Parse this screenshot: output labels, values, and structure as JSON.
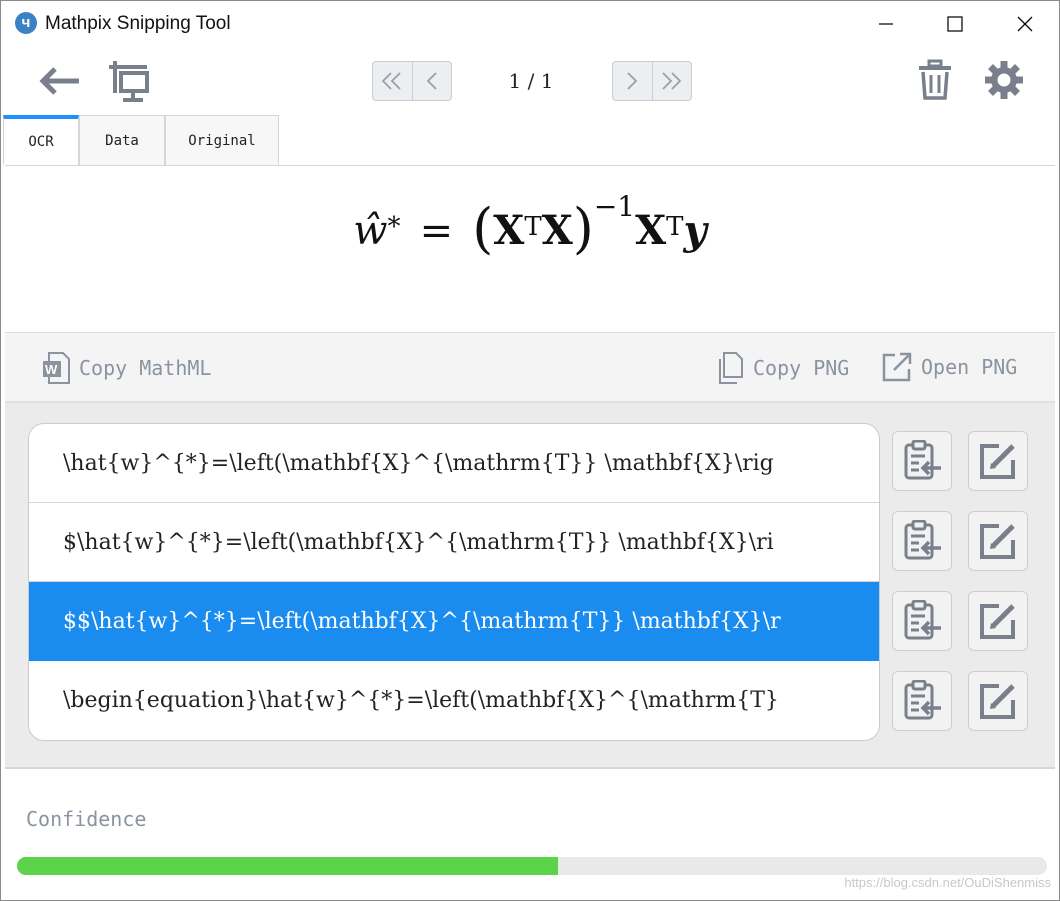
{
  "window": {
    "title": "Mathpix Snipping Tool",
    "logo_glyph": "ч",
    "controls": [
      "minimize-icon",
      "maximize-icon",
      "close-icon"
    ]
  },
  "toolbar": {
    "back_icon": "arrow-left-icon",
    "snip_icon": "screen-crop-icon",
    "page_indicator": "1 / 1",
    "pager_left": [
      "double-chevron-left-icon",
      "chevron-left-icon"
    ],
    "pager_right": [
      "chevron-right-icon",
      "double-chevron-right-icon"
    ],
    "delete_icon": "trash-icon",
    "settings_icon": "gear-icon"
  },
  "tabs": [
    {
      "label": "OCR",
      "active": true
    },
    {
      "label": "Data",
      "active": false
    },
    {
      "label": "Original",
      "active": false
    }
  ],
  "preview": {
    "equation_parts": {
      "w": "ŵ",
      "star": "*",
      "eq": "=",
      "lp": "(",
      "X1": "X",
      "T1": "T",
      "X2": "X",
      "rp": ")",
      "inv": "−1",
      "X3": "X",
      "T2": "T",
      "y": "y"
    }
  },
  "actions": {
    "copy_mathml": "Copy MathML",
    "copy_png": "Copy PNG",
    "open_png": "Open PNG"
  },
  "results": [
    {
      "text": "\\hat{w}^{*}=\\left(\\mathbf{X}^{\\mathrm{T}} \\mathbf{X}\\rig",
      "selected": false
    },
    {
      "text": "$\\hat{w}^{*}=\\left(\\mathbf{X}^{\\mathrm{T}} \\mathbf{X}\\ri",
      "selected": false
    },
    {
      "text": "$$\\hat{w}^{*}=\\left(\\mathbf{X}^{\\mathrm{T}} \\mathbf{X}\\r",
      "selected": true
    },
    {
      "text": "\\begin{equation}\\hat{w}^{*}=\\left(\\mathbf{X}^{\\mathrm{T}",
      "selected": false
    }
  ],
  "row_buttons": [
    "clipboard-paste-icon",
    "edit-icon"
  ],
  "confidence": {
    "label": "Confidence",
    "value": 0.525,
    "color": "#5bd44a"
  },
  "watermark": "https://blog.csdn.net/OuDiShenmiss",
  "colors": {
    "accent": "#1a8cf0",
    "icon": "#7a7f8c"
  }
}
